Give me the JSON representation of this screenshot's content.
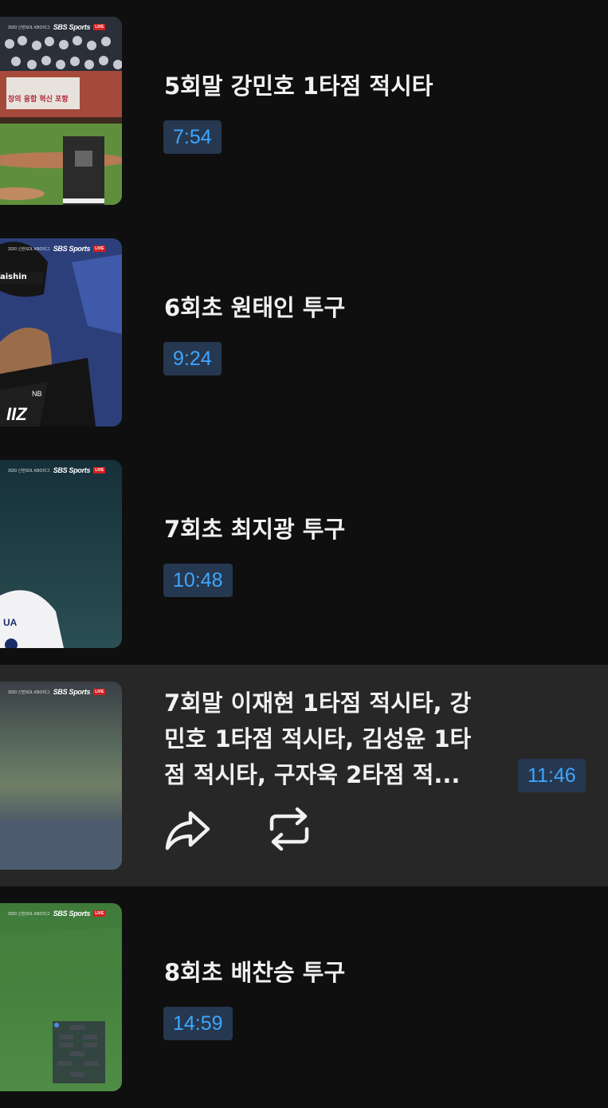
{
  "thumbnail_overlay": {
    "sbs_label": "SBS Sports",
    "live_label": "LIVE",
    "kbo_label": "2020 신한SOL KBO리그"
  },
  "videos": [
    {
      "title": "5회말 강민호 1타점 적시타",
      "duration": "7:54",
      "thumb_sign": "창의 융합 혁신 포항"
    },
    {
      "title": "6회초 원태인 투구",
      "duration": "9:24",
      "thumb_sign": "aishin"
    },
    {
      "title": "7회초 최지광 투구",
      "duration": "10:48"
    },
    {
      "title": "7회말 이재현 1타점 적시타, 강민호 1타점 적시타, 김성윤 1타점 적시타, 구자욱 2타점 적...",
      "duration": "11:46",
      "selected": true
    },
    {
      "title": "8회초 배찬승 투구",
      "duration": "14:59"
    }
  ],
  "icons": {
    "share": "share-icon",
    "repeat": "repeat-icon"
  },
  "colors": {
    "background": "#0f0f0f",
    "selected_row": "#272727",
    "duration_bg": "#263850",
    "duration_text": "#3ea6ff"
  }
}
